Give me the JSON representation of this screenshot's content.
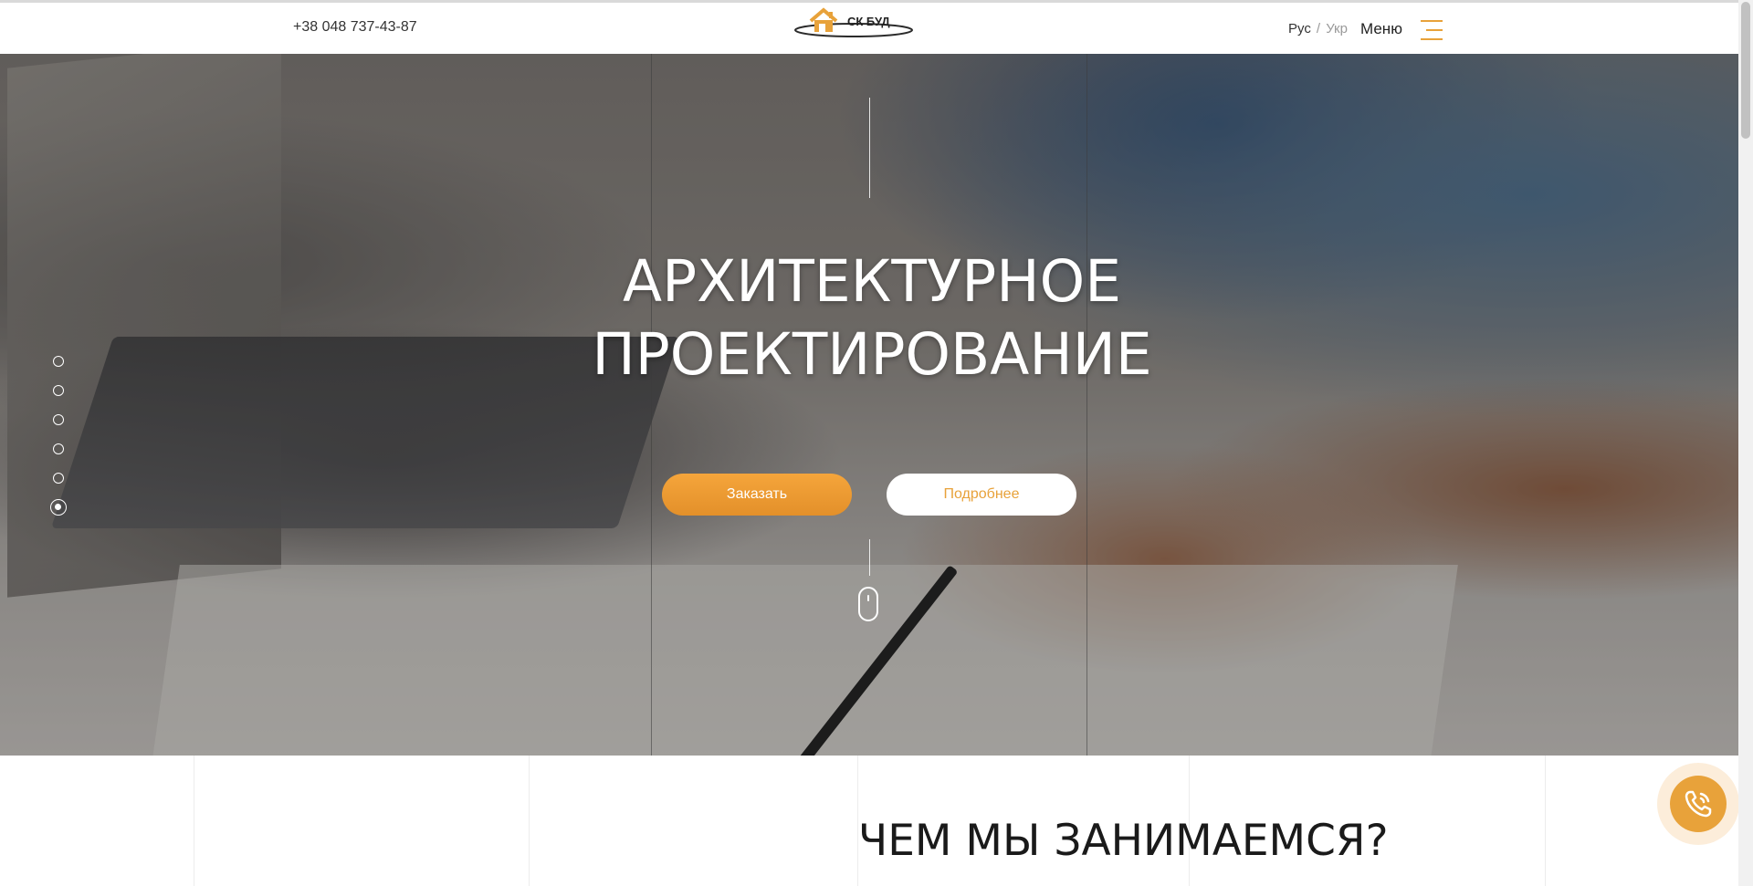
{
  "header": {
    "phone": "+38 048 737-43-87",
    "logo_text": "СК БУД",
    "lang_ru": "Рус",
    "lang_sep": "/",
    "lang_ua": "Укр",
    "menu_label": "Меню"
  },
  "hero": {
    "title_line1": "АРХИТЕКТУРНОЕ",
    "title_line2": "ПРОЕКТИРОВАНИЕ",
    "order_button": "Заказать",
    "more_button": "Подробнее",
    "slides_count": 6,
    "active_slide": 6
  },
  "section": {
    "title": "ЧЕМ МЫ ЗАНИМАЕМСЯ?"
  },
  "colors": {
    "accent": "#e8a23a",
    "text_dark": "#222222",
    "text_muted": "#9a9a9a"
  },
  "icons": {
    "logo": "house-logo-icon",
    "menu": "hamburger-icon",
    "scroll": "mouse-scroll-icon",
    "call": "phone-call-icon"
  }
}
